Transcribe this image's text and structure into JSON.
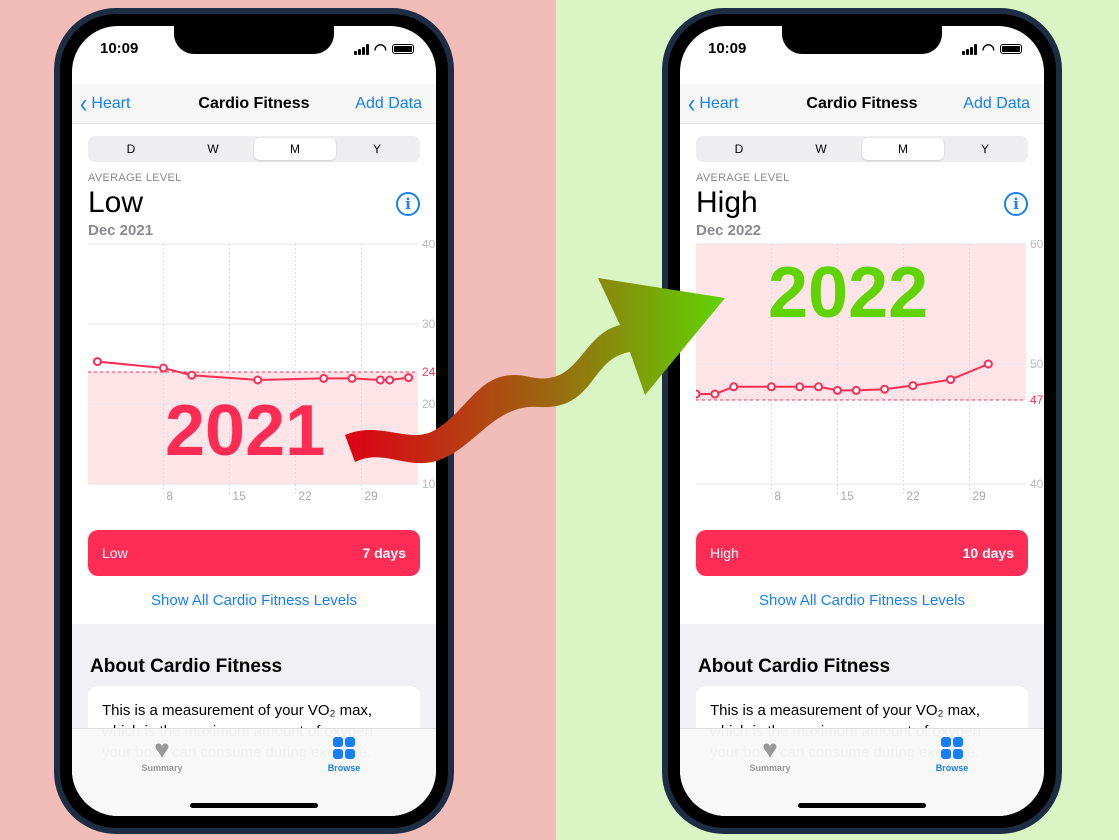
{
  "left": {
    "time": "10:09",
    "nav": {
      "back": "Heart",
      "title": "Cardio Fitness",
      "action": "Add Data"
    },
    "segments": [
      "D",
      "W",
      "M",
      "Y"
    ],
    "active_segment": "M",
    "average_label": "AVERAGE LEVEL",
    "level": "Low",
    "date": "Dec 2021",
    "summary": {
      "label": "Low",
      "days": "7 days"
    },
    "show_all": "Show All Cardio Fitness Levels",
    "about_title": "About Cardio Fitness",
    "about_text_1": "This is a measurement of your VO₂ max,",
    "about_text_2": "which is the maximum amount of oxygen",
    "about_text_3": "your body can consume during exercise.",
    "tabs": {
      "summary": "Summary",
      "browse": "Browse"
    },
    "overlay_year": "2021"
  },
  "right": {
    "time": "10:09",
    "nav": {
      "back": "Heart",
      "title": "Cardio Fitness",
      "action": "Add Data"
    },
    "segments": [
      "D",
      "W",
      "M",
      "Y"
    ],
    "active_segment": "M",
    "average_label": "AVERAGE LEVEL",
    "level": "High",
    "date": "Dec 2022",
    "summary": {
      "label": "High",
      "days": "10 days"
    },
    "show_all": "Show All Cardio Fitness Levels",
    "about_title": "About Cardio Fitness",
    "about_text_1": "This is a measurement of your VO₂ max,",
    "about_text_2": "which is the maximum amount of oxygen",
    "about_text_3": "your body can consume during exercise.",
    "tabs": {
      "summary": "Summary",
      "browse": "Browse"
    },
    "overlay_year": "2022"
  },
  "colors": {
    "accent": "#157efb",
    "line": "#ff2d55",
    "band": "#ffe4e8",
    "year_left": "#ff2d55",
    "year_right": "#5fd400"
  },
  "chart_data": [
    {
      "type": "line",
      "title": "Cardio Fitness Dec 2021",
      "x_ticks": [
        "8",
        "15",
        "22",
        "29"
      ],
      "x_tick_days": [
        8,
        15,
        22,
        29
      ],
      "ylim": [
        10,
        40
      ],
      "y_ticks": [
        10,
        20,
        30,
        40
      ],
      "threshold": 24,
      "band": [
        10,
        24
      ],
      "x": [
        1,
        8,
        11,
        18,
        25,
        28,
        31,
        32,
        34
      ],
      "values": [
        25.3,
        24.5,
        23.6,
        23.0,
        23.2,
        23.2,
        23.0,
        23.0,
        23.3
      ]
    },
    {
      "type": "line",
      "title": "Cardio Fitness Dec 2022",
      "x_ticks": [
        "8",
        "15",
        "22",
        "29"
      ],
      "x_tick_days": [
        8,
        15,
        22,
        29
      ],
      "ylim": [
        40,
        60
      ],
      "y_ticks": [
        40,
        50,
        60
      ],
      "threshold": 47,
      "band": [
        47,
        60
      ],
      "x": [
        0,
        2,
        4,
        8,
        11,
        13,
        15,
        17,
        20,
        23,
        27,
        31
      ],
      "values": [
        47.5,
        47.5,
        48.1,
        48.1,
        48.1,
        48.1,
        47.8,
        47.8,
        47.9,
        48.2,
        48.7,
        50.0
      ]
    }
  ]
}
